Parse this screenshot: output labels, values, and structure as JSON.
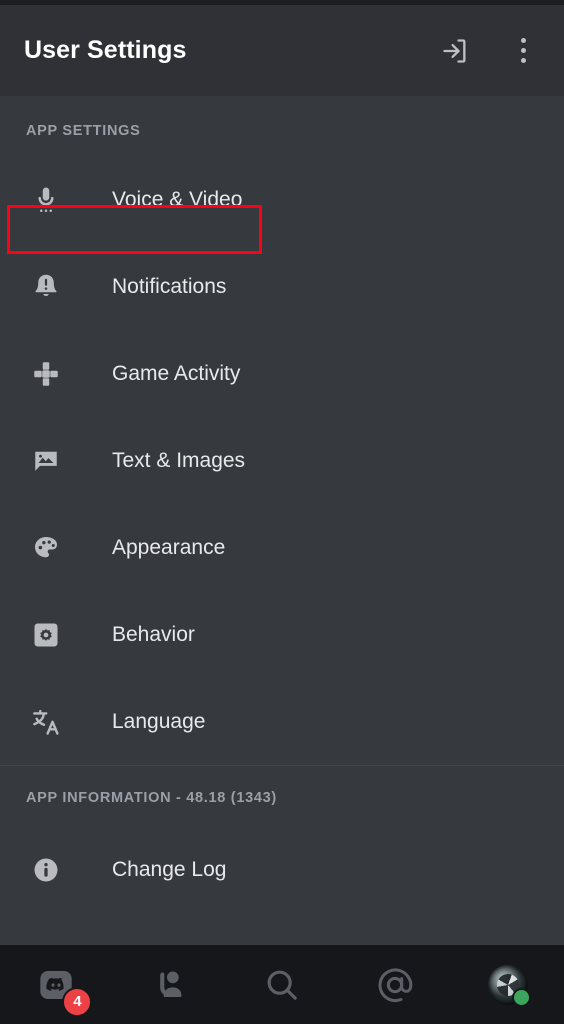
{
  "header": {
    "title": "User Settings",
    "logout_icon": "logout-icon",
    "overflow_icon": "more-vertical-icon"
  },
  "sections": [
    {
      "key": "app_settings",
      "title": "APP SETTINGS",
      "highlighted": true,
      "items": [
        {
          "icon": "microphone-icon",
          "label": "Voice & Video"
        },
        {
          "icon": "bell-alert-icon",
          "label": "Notifications"
        },
        {
          "icon": "gamepad-icon",
          "label": "Game Activity"
        },
        {
          "icon": "image-message-icon",
          "label": "Text & Images"
        },
        {
          "icon": "palette-icon",
          "label": "Appearance"
        },
        {
          "icon": "gear-square-icon",
          "label": "Behavior"
        },
        {
          "icon": "translate-icon",
          "label": "Language"
        }
      ]
    },
    {
      "key": "app_information",
      "title": "APP INFORMATION - 48.18 (1343)",
      "highlighted": false,
      "items": [
        {
          "icon": "info-icon",
          "label": "Change Log"
        }
      ]
    }
  ],
  "annotation": {
    "target": "APP SETTINGS",
    "color": "#ff0014"
  },
  "bottom_nav": {
    "items": [
      {
        "icon": "discord-servers-icon",
        "badge": "4",
        "active": false
      },
      {
        "icon": "friends-icon",
        "badge": null,
        "active": false
      },
      {
        "icon": "search-icon",
        "badge": null,
        "active": false
      },
      {
        "icon": "mentions-icon",
        "badge": null,
        "active": false
      },
      {
        "icon": "user-avatar",
        "badge": null,
        "active": false,
        "status": "online"
      }
    ]
  },
  "colors": {
    "header_bg": "#2f3136",
    "body_bg": "#36393e",
    "nav_bg": "#16171b",
    "icon": "#b9bbbe",
    "text": "#e8e9eb",
    "muted": "#9aa0a7",
    "badge": "#ed4245",
    "online": "#3ba55d",
    "annotation": "#ff0014"
  }
}
